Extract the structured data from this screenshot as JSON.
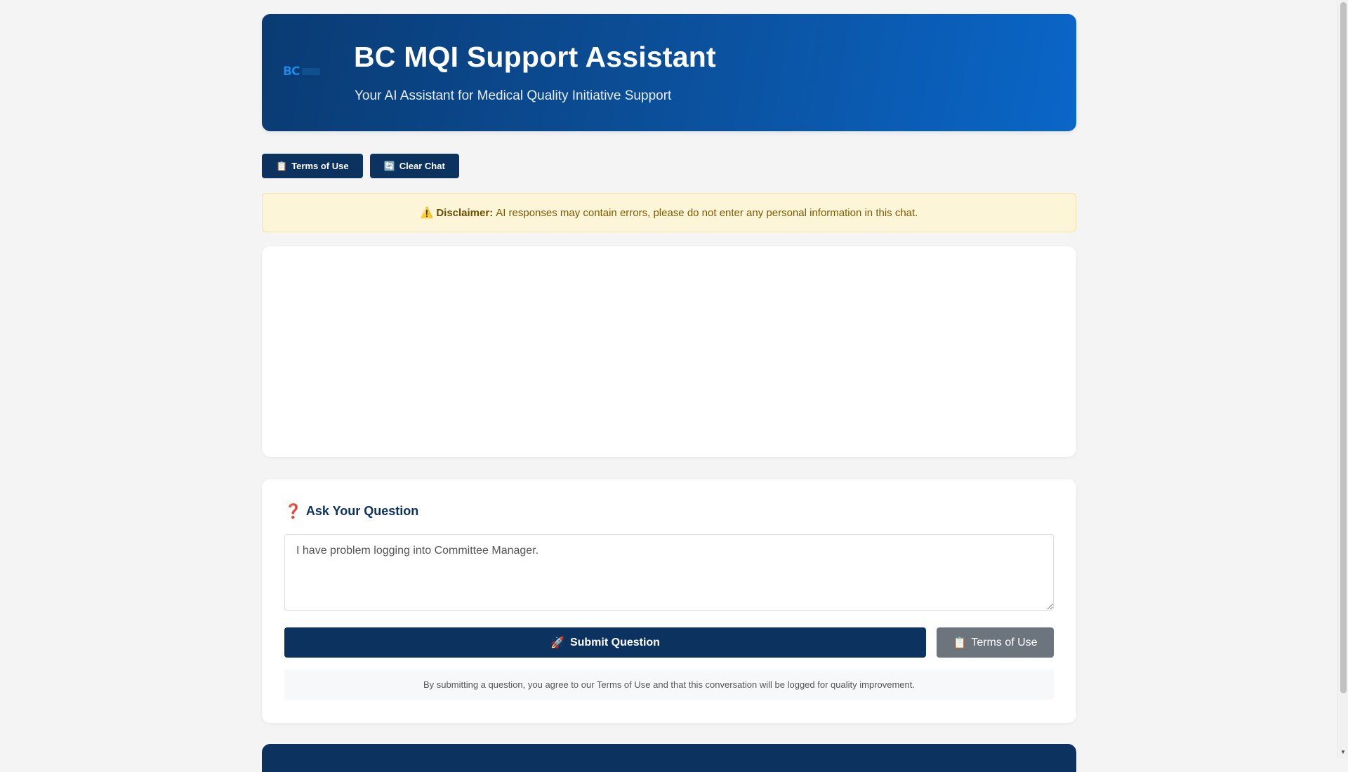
{
  "header": {
    "logo_text": "BC",
    "title": "BC MQI Support Assistant",
    "subtitle": "Your AI Assistant for Medical Quality Initiative Support"
  },
  "toolbar": {
    "terms_icon": "📋",
    "terms_label": "Terms of Use",
    "clear_icon": "🔄",
    "clear_label": "Clear Chat"
  },
  "disclaimer": {
    "icon": "⚠️",
    "label": "Disclaimer:",
    "text": "AI responses may contain errors, please do not enter any personal information in this chat."
  },
  "ask": {
    "icon": "❓",
    "title": "Ask Your Question",
    "input_value": "I have problem logging into Committee Manager.",
    "submit_icon": "🚀",
    "submit_label": "Submit Question",
    "terms_icon": "📋",
    "terms_label": "Terms of Use",
    "note": "By submitting a question, you agree to our Terms of Use and that this conversation will be logged for quality improvement."
  },
  "colors": {
    "primary": "#0c3260",
    "header_gradient_end": "#0a66c8",
    "disclaimer_bg": "#fdf5d8",
    "secondary_button": "#6c757d"
  }
}
